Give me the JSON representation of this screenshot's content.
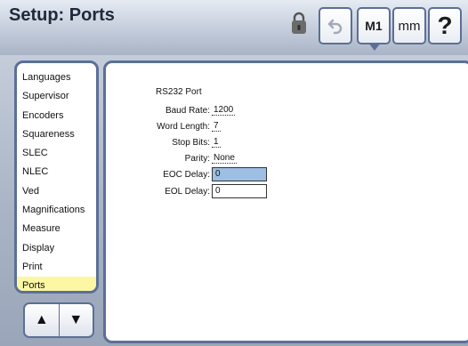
{
  "header": {
    "title": "Setup: Ports",
    "lock_icon": "lock-icon",
    "undo_icon": "undo-icon",
    "m1_label": "M1",
    "mm_label": "mm",
    "help_label": "?"
  },
  "sidebar": {
    "items": [
      {
        "label": "Languages"
      },
      {
        "label": "Supervisor"
      },
      {
        "label": "Encoders"
      },
      {
        "label": "Squareness"
      },
      {
        "label": "SLEC"
      },
      {
        "label": "NLEC"
      },
      {
        "label": "Ved"
      },
      {
        "label": "Magnifications"
      },
      {
        "label": "Measure"
      },
      {
        "label": "Display"
      },
      {
        "label": "Print"
      },
      {
        "label": "Ports"
      }
    ],
    "selected": "Ports",
    "highlight_color": "#fbf7a3"
  },
  "nav": {
    "up_icon": "▲",
    "down_icon": "▼"
  },
  "panel": {
    "heading": "RS232 Port",
    "fields": {
      "baud_rate": {
        "label": "Baud Rate:",
        "value": "1200"
      },
      "word_length": {
        "label": "Word Length:",
        "value": "7"
      },
      "stop_bits": {
        "label": "Stop Bits:",
        "value": "1"
      },
      "parity": {
        "label": "Parity:",
        "value": "None"
      },
      "eoc_delay": {
        "label": "EOC Delay:",
        "value": "0"
      },
      "eol_delay": {
        "label": "EOL Delay:",
        "value": "0"
      }
    },
    "focus_color": "#9dbfe3"
  }
}
